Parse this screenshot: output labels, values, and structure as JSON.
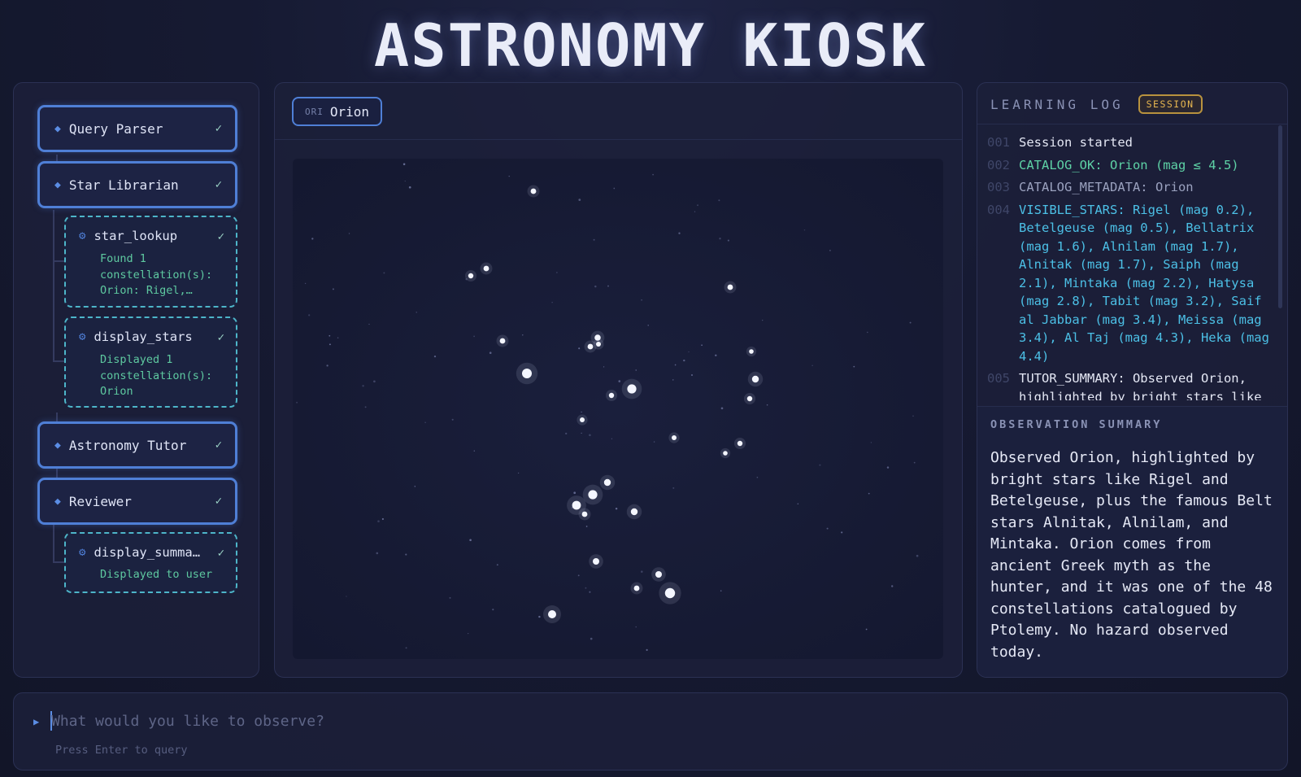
{
  "app": {
    "title": "ASTRONOMY KIOSK"
  },
  "pipeline": {
    "agents": [
      {
        "name": "Query Parser",
        "status": "✓"
      },
      {
        "name": "Star Librarian",
        "status": "✓"
      },
      {
        "name": "Astronomy Tutor",
        "status": "✓"
      },
      {
        "name": "Reviewer",
        "status": "✓"
      }
    ],
    "tools": [
      {
        "name": "star_lookup",
        "status": "✓",
        "result": "Found 1 constellation(s): Orion: Rigel,…"
      },
      {
        "name": "display_stars",
        "status": "✓",
        "result": "Displayed 1 constellation(s): Orion"
      },
      {
        "name": "display_summa…",
        "status": "✓",
        "result": "Displayed to user"
      }
    ]
  },
  "constellation": {
    "abbr": "ORI",
    "name": "Orion"
  },
  "log": {
    "title": "LEARNING LOG",
    "badge": "SESSION",
    "entries": [
      {
        "n": "001",
        "text": "Session started"
      },
      {
        "n": "002",
        "text": "CATALOG_OK: Orion (mag ≤ 4.5)"
      },
      {
        "n": "003",
        "text": "CATALOG_METADATA: Orion"
      },
      {
        "n": "004",
        "text": "VISIBLE_STARS: Rigel (mag 0.2), Betelgeuse (mag 0.5), Bellatrix (mag 1.6), Alnilam (mag 1.7), Alnitak (mag 1.7), Saiph (mag 2.1), Mintaka (mag 2.2), Hatysa (mag 2.8), Tabit (mag 3.2), Saif al Jabbar (mag 3.4), Meissa (mag 3.4), Al Taj (mag 4.3), Heka (mag 4.4)"
      },
      {
        "n": "005",
        "text": "TUTOR_SUMMARY: Observed Orion, highlighted by bright stars like"
      }
    ]
  },
  "summary": {
    "title": "OBSERVATION SUMMARY",
    "text": "Observed Orion, highlighted by bright stars like Rigel and Betelgeuse, plus the famous Belt stars Alnitak, Alnilam, and Mintaka. Orion comes from ancient Greek myth as the hunter, and it was one of the 48 constellations catalogued by Ptolemy. No hazard observed today."
  },
  "query": {
    "placeholder": "What would you like to observe?",
    "hint": "Press Enter to query",
    "prompt_icon": "play-triangle-icon"
  },
  "colors": {
    "accent": "#4f7fd6",
    "tool_border": "#4db5c9",
    "success": "#5ed2a6",
    "badge": "#e7b650"
  }
}
